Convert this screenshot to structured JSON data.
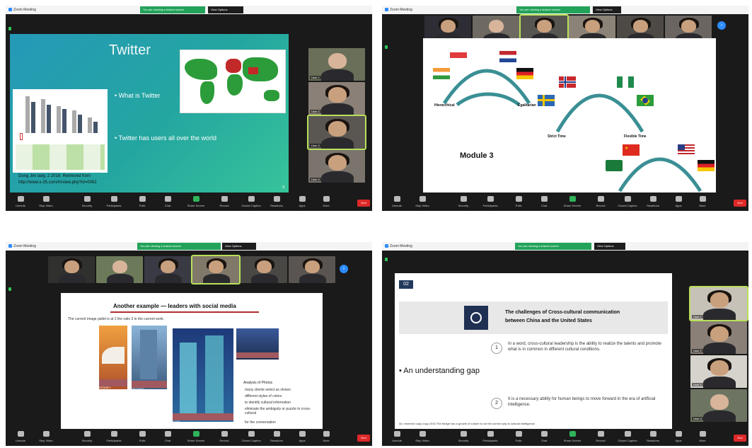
{
  "toolbar": {
    "buttons": [
      "Unmute",
      "Stop Video",
      "Security",
      "Participants",
      "Polls",
      "Chat",
      "Share Screen",
      "Record",
      "Closed Caption",
      "Reactions",
      "Apps",
      "More"
    ],
    "end_label": "End"
  },
  "p1": {
    "title": "Twitter",
    "bullet1": "• What is Twitter",
    "bullet2": "• Twitter has users all over the world",
    "cite1": "Dong Jim lady, 2 2016: Retrieved from",
    "cite2": "http://www.x-25.com/m/view.php?id=0062",
    "page_no": "9"
  },
  "p2": {
    "module": "Module 3",
    "arc1_left": "Hierarchical",
    "arc1_right": "Egalitarian",
    "arc2_left": "Strict Time",
    "arc2_right": "Flexible Time"
  },
  "p3": {
    "heading": "Another example — leaders with social media",
    "subtitle": "The current image pallet is at 2 the ratio 2 in the current work.",
    "label1": "SYDNEY",
    "label2": "SEOGHO",
    "label3": "D.N.E",
    "label4": "Riyadh",
    "list_title": "Analysis of Photos",
    "list_items": [
      "many clients select as shown",
      "different styles of colors",
      "to identify cultural information",
      "eliminate the ambiguity or puzzle to cross-cultural",
      "for the conversation"
    ]
  },
  "p4": {
    "badge": "02",
    "header_line1": "The challenges of Cross-cultural communication",
    "header_line2": "between China and the United States",
    "num1": "1",
    "text1": "In a word, cross-cultural leadership is the ability to realize the talents and promote what is in common in different cultural conditions.",
    "gap": "• An understanding gap",
    "num2": "2",
    "text2": "It is a necessary ability for human beings to move forward in the era of artificial intelligence.",
    "footer": "Ah, reserved copy copy 2016 The bridge has a growth of culture is not the correct way to cultural intelligence"
  },
  "colors": {
    "accent_green": "#23a35a",
    "end_red": "#e02828",
    "teal_slide": "#1f9ea3",
    "arc_teal": "#3a8f94",
    "badge_navy": "#223a5e",
    "active_speaker": "#b9e05a"
  }
}
